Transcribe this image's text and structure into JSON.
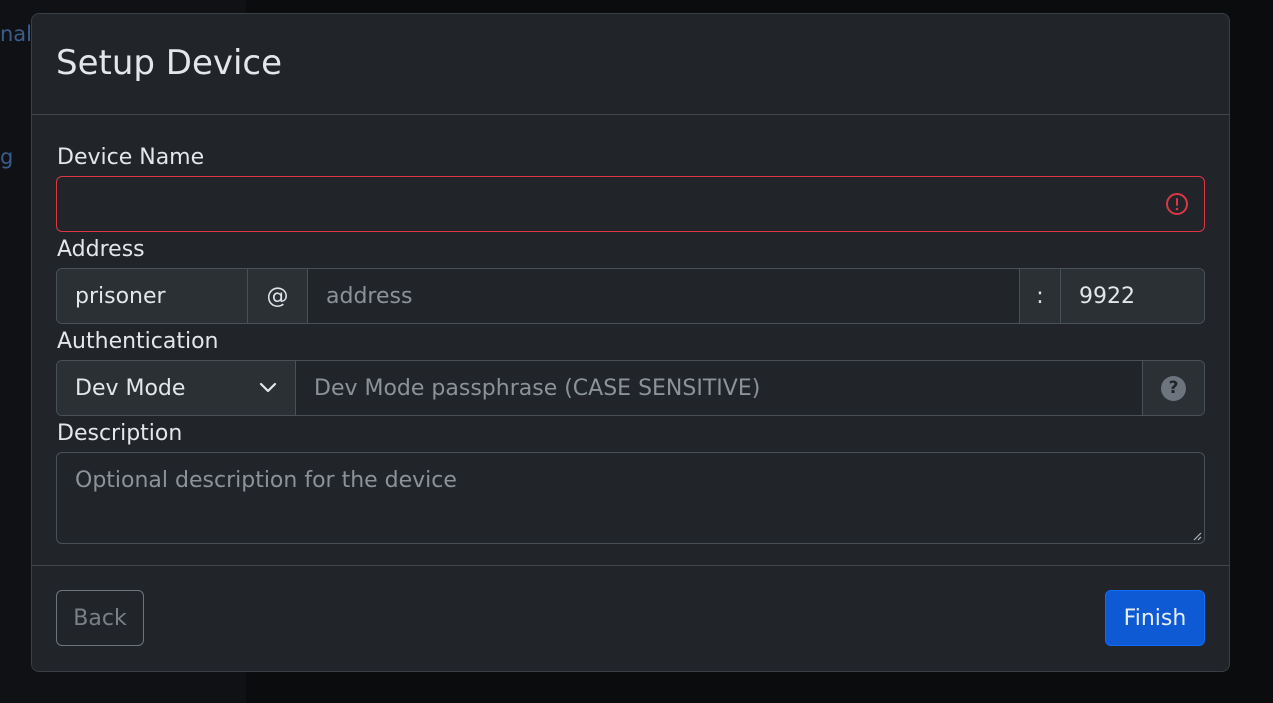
{
  "background": {
    "links": [
      "nal",
      "g"
    ]
  },
  "modal": {
    "title": "Setup Device",
    "device_name": {
      "label": "Device Name",
      "value": "",
      "placeholder": "",
      "invalid": true
    },
    "address": {
      "label": "Address",
      "username": "prisoner",
      "at_symbol": "@",
      "host_placeholder": "address",
      "host_value": "",
      "colon": ":",
      "port": "9922"
    },
    "authentication": {
      "label": "Authentication",
      "method": "Dev Mode",
      "passphrase_placeholder": "Dev Mode passphrase (CASE SENSITIVE)",
      "help_icon": "question-circle-icon",
      "help_glyph": "?"
    },
    "description": {
      "label": "Description",
      "placeholder": "Optional description for the device",
      "value": ""
    },
    "footer": {
      "back_label": "Back",
      "finish_label": "Finish"
    }
  },
  "colors": {
    "primary": "#0d6efd",
    "danger": "#dc3545",
    "modal_bg": "#212529"
  }
}
